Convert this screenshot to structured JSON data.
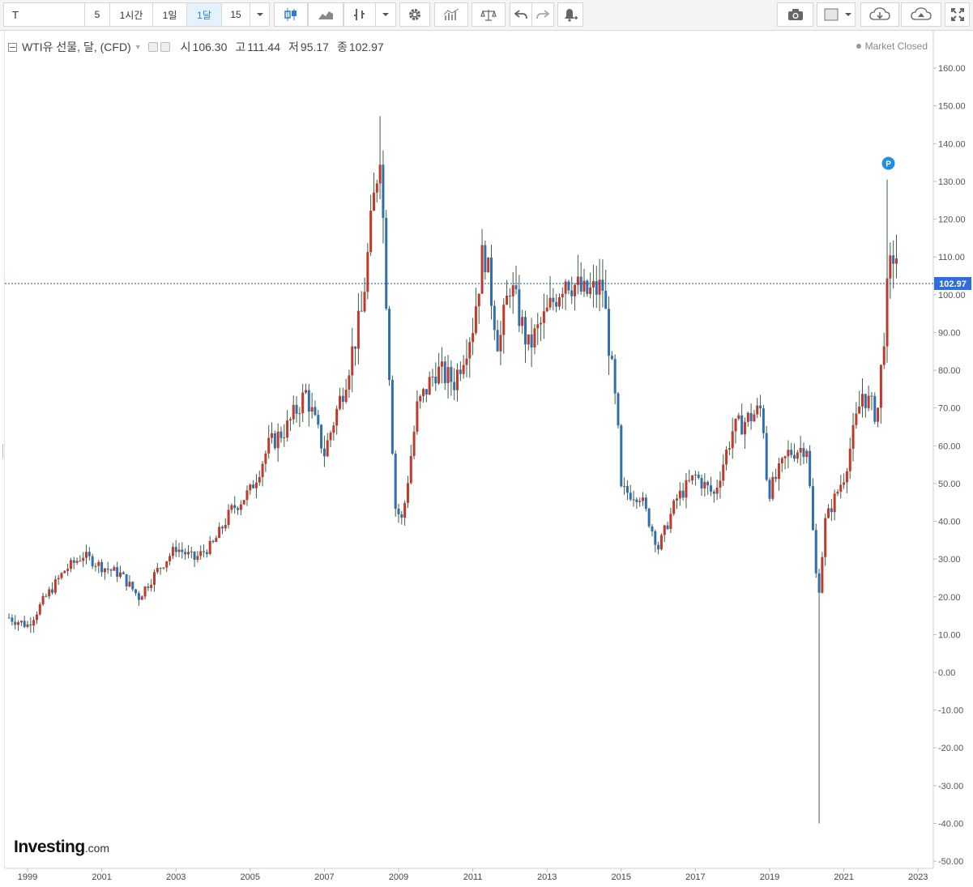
{
  "toolbar": {
    "symbol": "T",
    "intervals": [
      "5",
      "1시간",
      "1일",
      "1달",
      "15"
    ],
    "active_interval": "1달"
  },
  "legend": {
    "title": "WTI유 선물, 달, (CFD)",
    "open_label": "시",
    "open": "106.30",
    "high_label": "고",
    "high": "111.44",
    "low_label": "저",
    "low": "95.17",
    "close_label": "종",
    "close": "102.97"
  },
  "market_status": "Market Closed",
  "price_marker": "102.97",
  "pin_label": "P",
  "branding": {
    "name": "Investing",
    "suffix": ".com"
  },
  "colors": {
    "up": "#c0392b",
    "down": "#2e6fb0",
    "wick": "#3e5e44",
    "price_line": "#1f4f8a",
    "marker_bg": "#2f6ed8",
    "pin": "#1d8ee8"
  },
  "chart_data": {
    "type": "candlestick",
    "title": "WTI유 선물, 달, (CFD)",
    "period": "monthly",
    "x_ticks": [
      "1999",
      "2001",
      "2003",
      "2005",
      "2007",
      "2009",
      "2011",
      "2013",
      "2015",
      "2017",
      "2019",
      "2021",
      "2023"
    ],
    "y_ticks": [
      "160.00",
      "150.00",
      "140.00",
      "130.00",
      "120.00",
      "110.00",
      "100.00",
      "90.00",
      "80.00",
      "70.00",
      "60.00",
      "50.00",
      "40.00",
      "30.00",
      "20.00",
      "10.00",
      "0.00",
      "-10.00",
      "-20.00",
      "-30.00",
      "-40.00",
      "-50.00"
    ],
    "ylim": [
      -52,
      168
    ],
    "y_axis_position": "right",
    "last_close": 102.97,
    "monthly_close": [
      [
        1998.5,
        14.5
      ],
      [
        1999.0,
        12.5
      ],
      [
        1999.5,
        20
      ],
      [
        2000.0,
        27
      ],
      [
        2000.5,
        31
      ],
      [
        2001.0,
        28
      ],
      [
        2001.5,
        26
      ],
      [
        2002.0,
        20
      ],
      [
        2002.5,
        27
      ],
      [
        2003.0,
        33
      ],
      [
        2003.5,
        30
      ],
      [
        2004.0,
        34
      ],
      [
        2004.5,
        43
      ],
      [
        2005.0,
        48
      ],
      [
        2005.5,
        60
      ],
      [
        2006.0,
        65
      ],
      [
        2006.5,
        74
      ],
      [
        2007.0,
        58
      ],
      [
        2007.5,
        75
      ],
      [
        2008.0,
        95
      ],
      [
        2008.5,
        140
      ],
      [
        2008.9,
        44
      ],
      [
        2009.1,
        40
      ],
      [
        2009.5,
        70
      ],
      [
        2010.0,
        80
      ],
      [
        2010.5,
        77
      ],
      [
        2011.0,
        92
      ],
      [
        2011.3,
        113
      ],
      [
        2011.7,
        86
      ],
      [
        2012.0,
        103
      ],
      [
        2012.5,
        86
      ],
      [
        2013.0,
        95
      ],
      [
        2013.5,
        105
      ],
      [
        2014.0,
        100
      ],
      [
        2014.5,
        102
      ],
      [
        2014.9,
        66
      ],
      [
        2015.0,
        48
      ],
      [
        2015.5,
        47
      ],
      [
        2016.0,
        33
      ],
      [
        2016.5,
        46
      ],
      [
        2017.0,
        52
      ],
      [
        2017.5,
        47
      ],
      [
        2018.0,
        64
      ],
      [
        2018.8,
        70
      ],
      [
        2018.95,
        47
      ],
      [
        2019.5,
        58
      ],
      [
        2020.0,
        60
      ],
      [
        2020.3,
        19
      ],
      [
        2020.5,
        40
      ],
      [
        2021.0,
        52
      ],
      [
        2021.5,
        74
      ],
      [
        2021.9,
        68
      ],
      [
        2022.2,
        104
      ],
      [
        2022.4,
        114
      ],
      [
        2022.45,
        102.97
      ]
    ]
  }
}
